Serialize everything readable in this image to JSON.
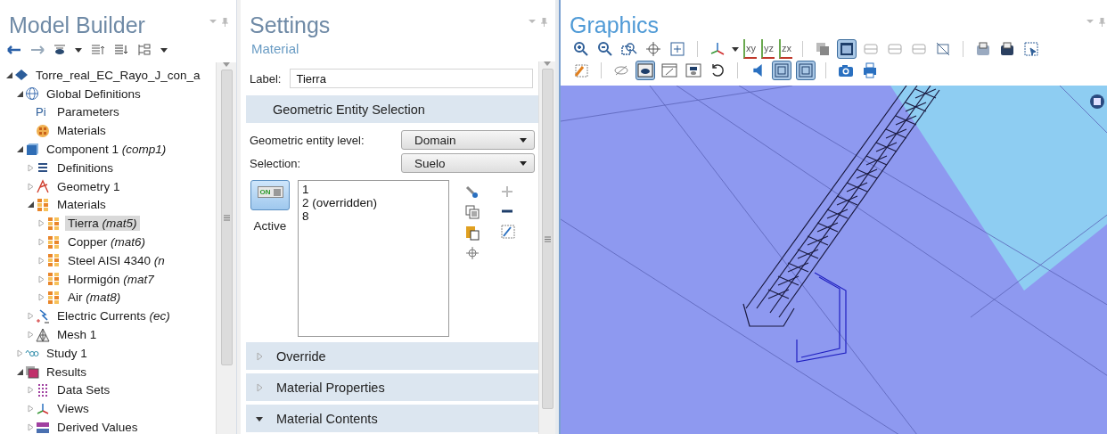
{
  "model_builder": {
    "title": "Model Builder",
    "tree": [
      {
        "label": "Torre_real_EC_Rayo_J_con_a",
        "kind": "model",
        "expanded": true,
        "selected": false,
        "children": [
          {
            "label": "Global Definitions",
            "kind": "globe",
            "expanded": true,
            "selected": false,
            "children": [
              {
                "label": "Parameters",
                "kind": "parameters",
                "glyph": "Pi",
                "selected": false
              },
              {
                "label": "Materials",
                "kind": "material-global",
                "selected": false
              }
            ]
          },
          {
            "label": "Component 1",
            "sub": "(comp1)",
            "kind": "component",
            "expanded": true,
            "selected": false,
            "children": [
              {
                "label": "Definitions",
                "kind": "definitions",
                "expanded": false,
                "selected": false
              },
              {
                "label": "Geometry 1",
                "kind": "geometry",
                "expanded": false,
                "selected": false
              },
              {
                "label": "Materials",
                "kind": "materials",
                "expanded": true,
                "selected": false,
                "children": [
                  {
                    "label": "Tierra",
                    "sub": "(mat5)",
                    "kind": "material",
                    "expanded": false,
                    "selected": true
                  },
                  {
                    "label": "Copper",
                    "sub": "(mat6)",
                    "kind": "material",
                    "expanded": false,
                    "selected": false
                  },
                  {
                    "label": "Steel AISI 4340",
                    "sub": "(n",
                    "kind": "material",
                    "expanded": false,
                    "selected": false
                  },
                  {
                    "label": "Hormigón",
                    "sub": "(mat7",
                    "kind": "material",
                    "expanded": false,
                    "selected": false
                  },
                  {
                    "label": "Air",
                    "sub": "(mat8)",
                    "kind": "material",
                    "expanded": false,
                    "selected": false
                  }
                ]
              },
              {
                "label": "Electric Currents",
                "sub": "(ec)",
                "kind": "physics",
                "expanded": false,
                "selected": false
              },
              {
                "label": "Mesh 1",
                "kind": "mesh",
                "expanded": false,
                "selected": false
              }
            ]
          },
          {
            "label": "Study 1",
            "kind": "study",
            "expanded": false,
            "selected": false
          },
          {
            "label": "Results",
            "kind": "results",
            "expanded": true,
            "selected": false,
            "children": [
              {
                "label": "Data Sets",
                "kind": "datasets",
                "expanded": false,
                "selected": false
              },
              {
                "label": "Views",
                "kind": "views",
                "expanded": false,
                "selected": false
              },
              {
                "label": "Derived Values",
                "kind": "derived",
                "expanded": false,
                "selected": false
              }
            ]
          }
        ]
      }
    ]
  },
  "settings": {
    "title": "Settings",
    "subtitle": "Material",
    "label_field": {
      "label": "Label:",
      "value": "Tierra"
    },
    "geometric_section": "Geometric Entity Selection",
    "dropdowns": [
      {
        "label": "Geometric entity level:",
        "value": "Domain"
      },
      {
        "label": "Selection:",
        "value": "Suelo"
      }
    ],
    "active_toggle": {
      "on": true,
      "on_text": "ON",
      "label": "Active"
    },
    "selection_list": [
      "1",
      "2 (overridden)",
      "8"
    ],
    "sections": [
      {
        "title": "Override",
        "expanded": false
      },
      {
        "title": "Material Properties",
        "expanded": false
      },
      {
        "title": "Material Contents",
        "expanded": true
      }
    ]
  },
  "graphics": {
    "title": "Graphics",
    "toolbar_rows": [
      [
        {
          "kind": "zoom-in",
          "pressed": false
        },
        {
          "kind": "zoom-out",
          "pressed": false
        },
        {
          "kind": "zoom-box",
          "pressed": false
        },
        {
          "kind": "zoom-center",
          "pressed": false
        },
        {
          "kind": "zoom-extents",
          "pressed": false
        },
        {
          "kind": "separator"
        },
        {
          "kind": "axes",
          "pressed": false
        },
        {
          "kind": "caret"
        },
        {
          "kind": "plane",
          "label": "xy",
          "pressed": false
        },
        {
          "kind": "plane",
          "label": "yz",
          "pressed": false
        },
        {
          "kind": "plane",
          "label": "zx",
          "pressed": false
        },
        {
          "kind": "separator"
        },
        {
          "kind": "transparency",
          "pressed": false
        },
        {
          "kind": "wireframe",
          "pressed": true
        },
        {
          "kind": "render",
          "pressed": false
        },
        {
          "kind": "render",
          "pressed": false
        },
        {
          "kind": "render",
          "pressed": false
        },
        {
          "kind": "hide-grid",
          "pressed": false
        },
        {
          "kind": "separator"
        },
        {
          "kind": "scene-light",
          "pressed": false
        },
        {
          "kind": "scene-dark",
          "pressed": false
        },
        {
          "kind": "select-box",
          "pressed": false
        }
      ],
      [
        {
          "kind": "clear-selection",
          "pressed": false
        },
        {
          "kind": "separator"
        },
        {
          "kind": "hide",
          "pressed": false
        },
        {
          "kind": "eye",
          "pressed": true
        },
        {
          "kind": "hide-box",
          "pressed": false
        },
        {
          "kind": "show-box",
          "pressed": false
        },
        {
          "kind": "reset",
          "pressed": false
        },
        {
          "kind": "separator"
        },
        {
          "kind": "speaker",
          "pressed": false
        },
        {
          "kind": "frame",
          "pressed": true
        },
        {
          "kind": "frame",
          "pressed": true
        },
        {
          "kind": "separator"
        },
        {
          "kind": "camera",
          "pressed": false
        },
        {
          "kind": "printer",
          "pressed": false
        }
      ]
    ]
  }
}
